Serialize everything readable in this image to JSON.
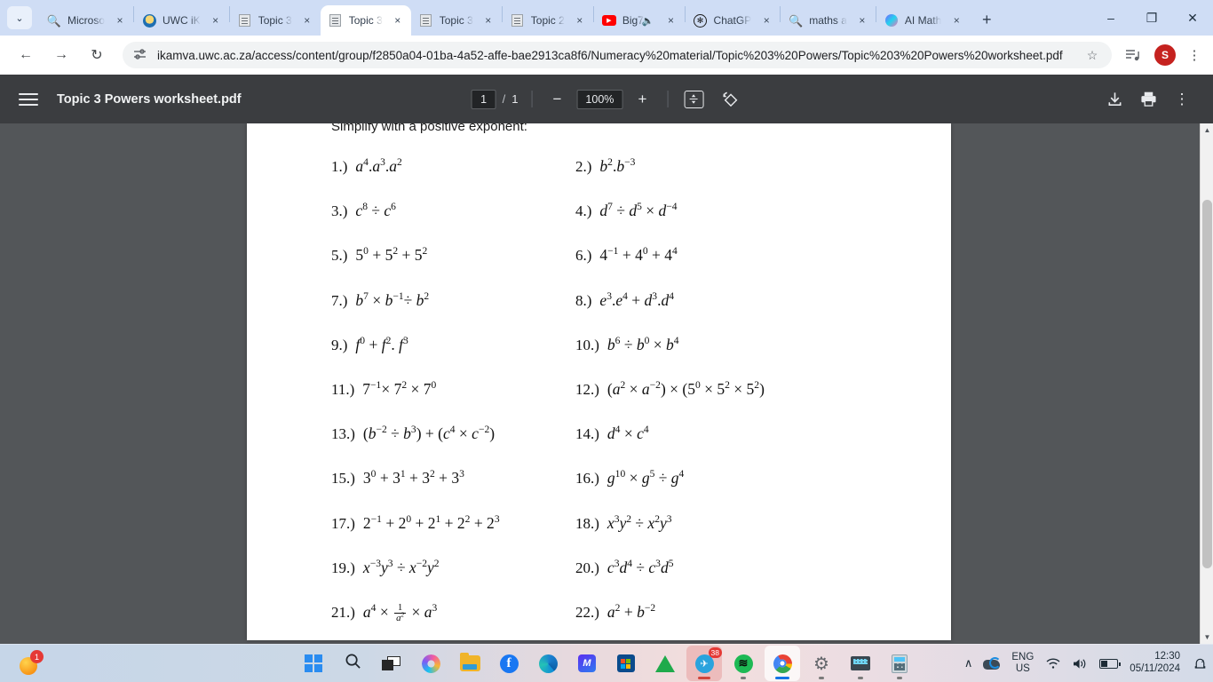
{
  "browser": {
    "tabs": [
      {
        "title": "Microso",
        "favicon": "search-icon",
        "muted": false,
        "active": false
      },
      {
        "title": "UWC iK",
        "favicon": "uwc-icon",
        "muted": false,
        "active": false
      },
      {
        "title": "Topic 3",
        "favicon": "pdf-doc-icon",
        "muted": false,
        "active": false
      },
      {
        "title": "Topic 3",
        "favicon": "pdf-doc-icon",
        "muted": false,
        "active": true
      },
      {
        "title": "Topic 3",
        "favicon": "pdf-doc-icon",
        "muted": false,
        "active": false
      },
      {
        "title": "Topic 2",
        "favicon": "pdf-doc-icon",
        "muted": false,
        "active": false
      },
      {
        "title": "Big7",
        "favicon": "youtube-icon",
        "muted": true,
        "active": false
      },
      {
        "title": "ChatGP",
        "favicon": "chatgpt-icon",
        "muted": false,
        "active": false
      },
      {
        "title": "maths a",
        "favicon": "search-icon",
        "muted": false,
        "active": false
      },
      {
        "title": "AI Math",
        "favicon": "ai-orb-icon",
        "muted": false,
        "active": false
      }
    ],
    "tab_close_label": "×",
    "new_tab_label": "+",
    "tab_list_chevron": "⌄",
    "window_controls": {
      "minimize": "–",
      "maximize": "❐",
      "close": "✕"
    },
    "nav": {
      "back": "←",
      "forward": "→",
      "reload": "↻"
    },
    "url": "ikamva.uwc.ac.za/access/content/group/f2850a04-01ba-4a52-affe-bae2913ca8f6/Numeracy%20material/Topic%203%20Powers/Topic%203%20Powers%20worksheet.pdf",
    "bookmark_star": "☆",
    "profile_initial": "S",
    "menu_kebab": "⋮",
    "reading_list_icon": "≡♪"
  },
  "pdf_viewer": {
    "title": "Topic 3 Powers worksheet.pdf",
    "page_current": "1",
    "page_separator": "/",
    "page_total": "1",
    "zoom_out_label": "−",
    "zoom_level": "100%",
    "zoom_in_label": "+",
    "fit_label": "↕",
    "rotate_label": "⟲",
    "download_label": "⬇",
    "print_label": "⎙",
    "more_label": "⋮"
  },
  "document": {
    "instruction": "Simplify with a positive exponent:",
    "questions": [
      {
        "num": "1.)",
        "html": "<i>a</i><sup>4</sup>.<i>a</i><sup>3</sup>.<i>a</i><sup>2</sup>"
      },
      {
        "num": "2.)",
        "html": "<i>b</i><sup>2</sup>.<i>b</i><sup>−3</sup>"
      },
      {
        "num": "3.)",
        "html": "<i>c</i><sup>8</sup> ÷ <i>c</i><sup>6</sup>"
      },
      {
        "num": "4.)",
        "html": "<i>d</i><sup>7</sup> ÷ <i>d</i><sup>5</sup> <span class='op'>×</span> <i>d</i><sup>−4</sup>"
      },
      {
        "num": "5.)",
        "html": "5<sup>0</sup> + 5<sup>2</sup> + 5<sup>2</sup>"
      },
      {
        "num": "6.)",
        "html": "4<sup>−1</sup> + 4<sup>0</sup> + 4<sup>4</sup>"
      },
      {
        "num": "7.)",
        "html": "<i>b</i><sup>7</sup> <span class='op'>×</span> <i>b</i><sup>−1</sup>÷ <i>b</i><sup>2</sup>"
      },
      {
        "num": "8.)",
        "html": "<i>e</i><sup>3</sup>.<i>e</i><sup>4</sup> + <i>d</i><sup>3</sup>.<i>d</i><sup>4</sup>"
      },
      {
        "num": "9.)",
        "html": "<i>f</i><sup>0</sup> + <i>f</i><sup>2</sup>. <i>f</i><sup>3</sup>"
      },
      {
        "num": "10.)",
        "html": "<i>b</i><sup>6</sup> ÷ <i>b</i><sup>0</sup> <span class='op'>×</span> <i>b</i><sup>4</sup>"
      },
      {
        "num": "11.)",
        "html": "7<sup>−1</sup><span class='op'>×</span> 7<sup>2</sup> <span class='op'>×</span> 7<sup>0</sup>"
      },
      {
        "num": "12.)",
        "html": "(<i>a</i><sup>2</sup> <span class='op'>×</span> <i>a</i><sup>−2</sup>) <span class='op'>×</span> (5<sup>0</sup> <span class='op'>×</span> 5<sup>2</sup> <span class='op'>×</span> 5<sup>2</sup>)"
      },
      {
        "num": "13.)",
        "html": "(<i>b</i><sup>−2</sup> ÷ <i>b</i><sup>3</sup>) + (<i>c</i><sup>4</sup> <span class='op'>×</span> <i>c</i><sup>−2</sup>)"
      },
      {
        "num": "14.)",
        "html": "<i>d</i><sup>4</sup> <span class='op'>×</span> <i>c</i><sup>4</sup>"
      },
      {
        "num": "15.)",
        "html": "3<sup>0</sup> + 3<sup>1</sup> + 3<sup>2</sup> + 3<sup>3</sup>"
      },
      {
        "num": "16.)",
        "html": "<i>g</i><sup>10</sup> <span class='op'>×</span> <i>g</i><sup>5</sup> ÷ <i>g</i><sup>4</sup>"
      },
      {
        "num": "17.)",
        "html": "2<sup>−1</sup> + 2<sup>0</sup> + 2<sup>1</sup> + 2<sup>2</sup> + 2<sup>3</sup>"
      },
      {
        "num": "18.)",
        "html": "<i>x</i><sup>3</sup><i>y</i><sup>2</sup> ÷ <i>x</i><sup>2</sup><i>y</i><sup>3</sup>"
      },
      {
        "num": "19.)",
        "html": "<i>x</i><sup>−3</sup><i>y</i><sup>3</sup> ÷ <i>x</i><sup>−2</sup><i>y</i><sup>2</sup>"
      },
      {
        "num": "20.)",
        "html": "<i>c</i><sup>3</sup><i>d</i><sup>4</sup> ÷ <i>c</i><sup>3</sup><i>d</i><sup>5</sup>"
      },
      {
        "num": "21.)",
        "html": "<i>a</i><sup>4</sup> <span class='op'>×</span> <span class='frac'><span class='num'>1</span><span class='den'>a<sup>2</sup></span></span> <span class='op'>×</span> <i>a</i><sup>3</sup>"
      },
      {
        "num": "22.)",
        "html": "<i>a</i><sup>2</sup> + <i>b</i><sup>−2</sup>"
      }
    ]
  },
  "scrollbar": {
    "up_arrow": "▲",
    "down_arrow": "▼"
  },
  "taskbar": {
    "notification_count": "1",
    "icons": [
      {
        "name": "start-button",
        "label": "Start"
      },
      {
        "name": "taskbar-search",
        "label": "Search"
      },
      {
        "name": "task-view",
        "label": "Task View"
      },
      {
        "name": "copilot",
        "label": "Copilot"
      },
      {
        "name": "file-explorer",
        "label": "File Explorer"
      },
      {
        "name": "facebook",
        "label": "Facebook"
      },
      {
        "name": "microsoft-edge",
        "label": "Microsoft Edge"
      },
      {
        "name": "violet-app",
        "label": "App"
      },
      {
        "name": "microsoft-store",
        "label": "Microsoft Store"
      },
      {
        "name": "green-triangle-app",
        "label": "App"
      },
      {
        "name": "telegram",
        "label": "Telegram",
        "badge": "38"
      },
      {
        "name": "spotify",
        "label": "Spotify"
      },
      {
        "name": "google-chrome",
        "label": "Google Chrome"
      },
      {
        "name": "settings",
        "label": "Settings"
      },
      {
        "name": "keyboard-app",
        "label": "Keyboard"
      },
      {
        "name": "calculator",
        "label": "Calculator"
      }
    ],
    "tray": {
      "overflow_chevron": "∧",
      "language_line1": "ENG",
      "language_line2": "US",
      "wifi_icon": "📶",
      "volume_icon": "🔊",
      "time": "12:30",
      "date": "05/11/2024",
      "notification_bell": "🔔"
    }
  }
}
